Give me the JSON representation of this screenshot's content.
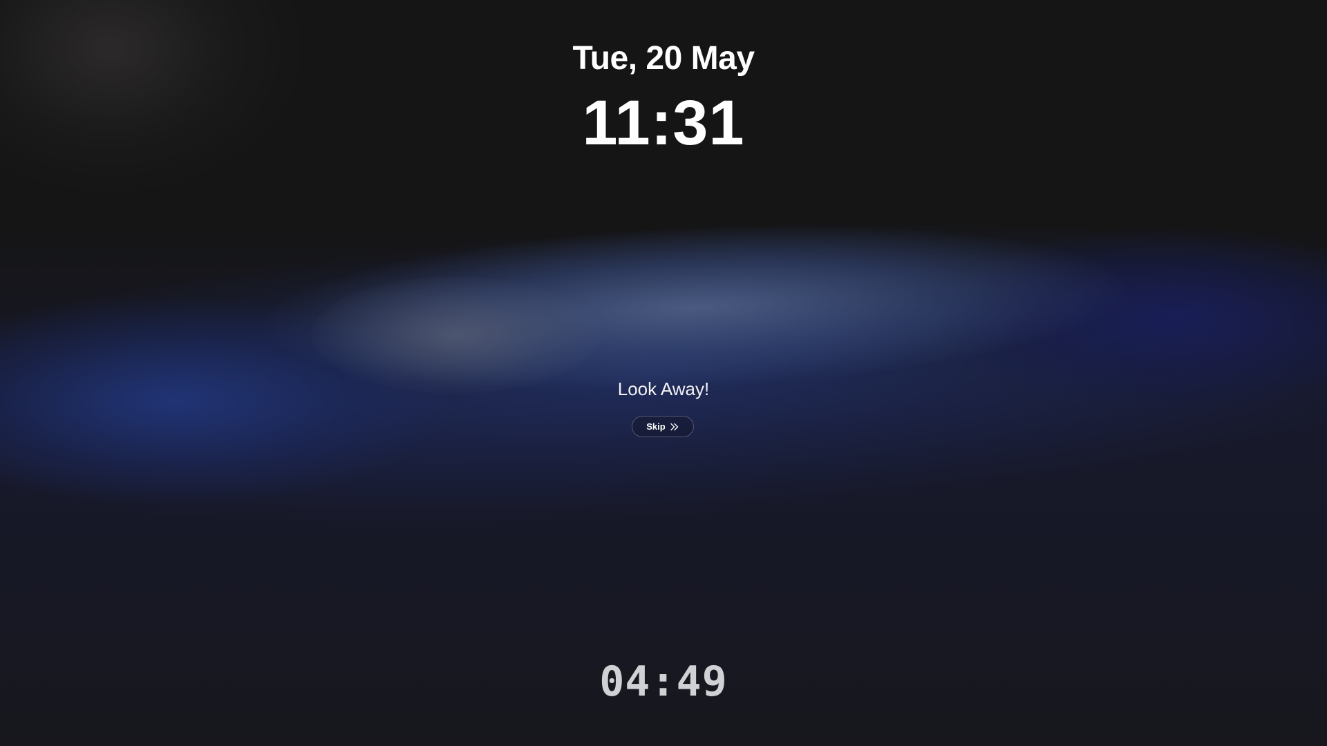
{
  "lock_screen": {
    "date": "Tue, 20 May",
    "time": "11:31"
  },
  "break": {
    "message": "Look Away!",
    "skip_label": "Skip",
    "skip_icon": "double-chevron-right-icon",
    "countdown": "04:49"
  },
  "colors": {
    "background": "#161618",
    "text": "#ffffff",
    "countdown_text": "#d0d1d5",
    "accent_blue": "#2a3f8a"
  }
}
